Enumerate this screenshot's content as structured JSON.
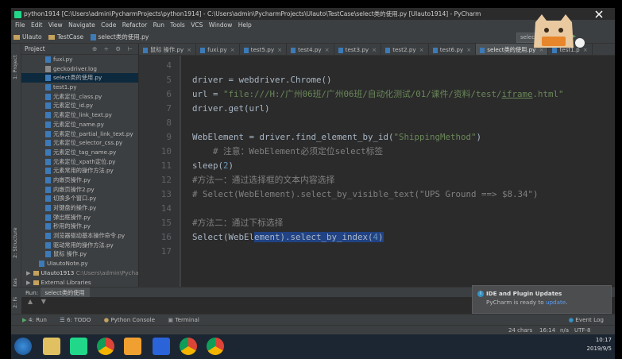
{
  "window": {
    "title": "python1914 [C:\\Users\\admin\\PycharmProjects\\python1914] - C:\\Users\\admin\\PycharmProjects\\UIauto\\TestCase\\select类的使用.py [UIauto1914] - PyCharm"
  },
  "menu": [
    "File",
    "Edit",
    "View",
    "Navigate",
    "Code",
    "Refactor",
    "Run",
    "Tools",
    "VCS",
    "Window",
    "Help"
  ],
  "breadcrumb": [
    "UIauto",
    "TestCase",
    "select类的使用.py"
  ],
  "toolbar_run_config": "select",
  "left_tool_tabs": [
    "1: Project",
    "2: Structure",
    "2: Favorites"
  ],
  "project_panel": {
    "title": "Project",
    "files": [
      {
        "name": "fuxi.py",
        "kind": "py"
      },
      {
        "name": "geckodriver.log",
        "kind": "log"
      },
      {
        "name": "select类的使用.py",
        "kind": "py",
        "selected": true
      },
      {
        "name": "test1.py",
        "kind": "py"
      },
      {
        "name": "元素定位_class.py",
        "kind": "py"
      },
      {
        "name": "元素定位_id.py",
        "kind": "py"
      },
      {
        "name": "元素定位_link_text.py",
        "kind": "py"
      },
      {
        "name": "元素定位_name.py",
        "kind": "py"
      },
      {
        "name": "元素定位_partial_link_text.py",
        "kind": "py"
      },
      {
        "name": "元素定位_selector_css.py",
        "kind": "py"
      },
      {
        "name": "元素定位_tag_name.py",
        "kind": "py"
      },
      {
        "name": "元素定位_xpath定位.py",
        "kind": "py"
      },
      {
        "name": "元素常用的操作方法.py",
        "kind": "py"
      },
      {
        "name": "内嵌页操作.py",
        "kind": "py"
      },
      {
        "name": "内嵌页操作2.py",
        "kind": "py"
      },
      {
        "name": "切换多个窗口.py",
        "kind": "py"
      },
      {
        "name": "对键盘的操作.py",
        "kind": "py"
      },
      {
        "name": "弹出框操作.py",
        "kind": "py"
      },
      {
        "name": "秒用的操作.py",
        "kind": "py"
      },
      {
        "name": "浏览器驱动基本操作命令.py",
        "kind": "py"
      },
      {
        "name": "驱动常用的操作方法.py",
        "kind": "py"
      },
      {
        "name": "鼠标 操作.py",
        "kind": "py"
      }
    ],
    "extra_file": "UIautoNote.py",
    "root2_name": "UIauto1913",
    "root2_path": "C:\\Users\\admin\\PycharmPr",
    "root3_name": "External Libraries"
  },
  "editor_tabs": [
    {
      "label": "鼠标 操作.py"
    },
    {
      "label": "fuxi.py"
    },
    {
      "label": "test5.py"
    },
    {
      "label": "test4.py"
    },
    {
      "label": "test3.py"
    },
    {
      "label": "test2.py"
    },
    {
      "label": "test6.py"
    },
    {
      "label": "select类的使用.py",
      "active": true
    },
    {
      "label": "test1.p"
    }
  ],
  "line_numbers": [
    "4",
    "5",
    "6",
    "7",
    "8",
    "9",
    "10",
    "11",
    "12",
    "13",
    "14",
    "15",
    "16",
    "17"
  ],
  "code": {
    "l5": "driver = webdriver.Chrome()",
    "l6_a": "url = ",
    "l6_b": "\"file:///H:/广州06班/广州06班/自动化测试/01/课件/资料/test/",
    "l6_c": "iframe",
    "l6_d": ".html\"",
    "l7": "driver.get(url)",
    "l9_a": "WebElement = driver.find_element_by_id(",
    "l9_b": "\"ShippingMethod\"",
    "l9_c": ")",
    "l10": "# 注意：WebElement必须定位select标签",
    "l11_a": "sleep(",
    "l11_b": "2",
    "l11_c": ")",
    "l12": "#方法一：通过选择框的文本内容选择",
    "l13": "# Select(WebElement).select_by_visible_text(\"UPS Ground ==> $8.34\")",
    "l15": "#方法二：通过下标选择",
    "l16_a": "Select(WebEl",
    "l16_b": "ement).select_by_index(",
    "l16_c": "4",
    "l16_d": ")"
  },
  "run_panel": {
    "label": "Run:",
    "tab": "select类的使用"
  },
  "bottom_tools": [
    {
      "label": "4: Run"
    },
    {
      "label": "6: TODO"
    },
    {
      "label": "Python Console"
    },
    {
      "label": "Terminal"
    },
    {
      "label": "Event Log"
    }
  ],
  "status_bar": {
    "chars": "24 chars",
    "position": "16:14",
    "line_sep": "n/a",
    "encoding": "UTF-8"
  },
  "notification": {
    "title": "IDE and Plugin Updates",
    "body": "PyCharm is ready to ",
    "link": "update",
    "tail": "."
  },
  "clock": {
    "time": "10:17",
    "date": "2019/9/5"
  },
  "colors": {
    "editor_bg": "#2b2b2b",
    "panel_bg": "#3c3f41",
    "string": "#6a8759",
    "comment": "#808080",
    "number": "#6897bb",
    "selection": "#214283"
  }
}
